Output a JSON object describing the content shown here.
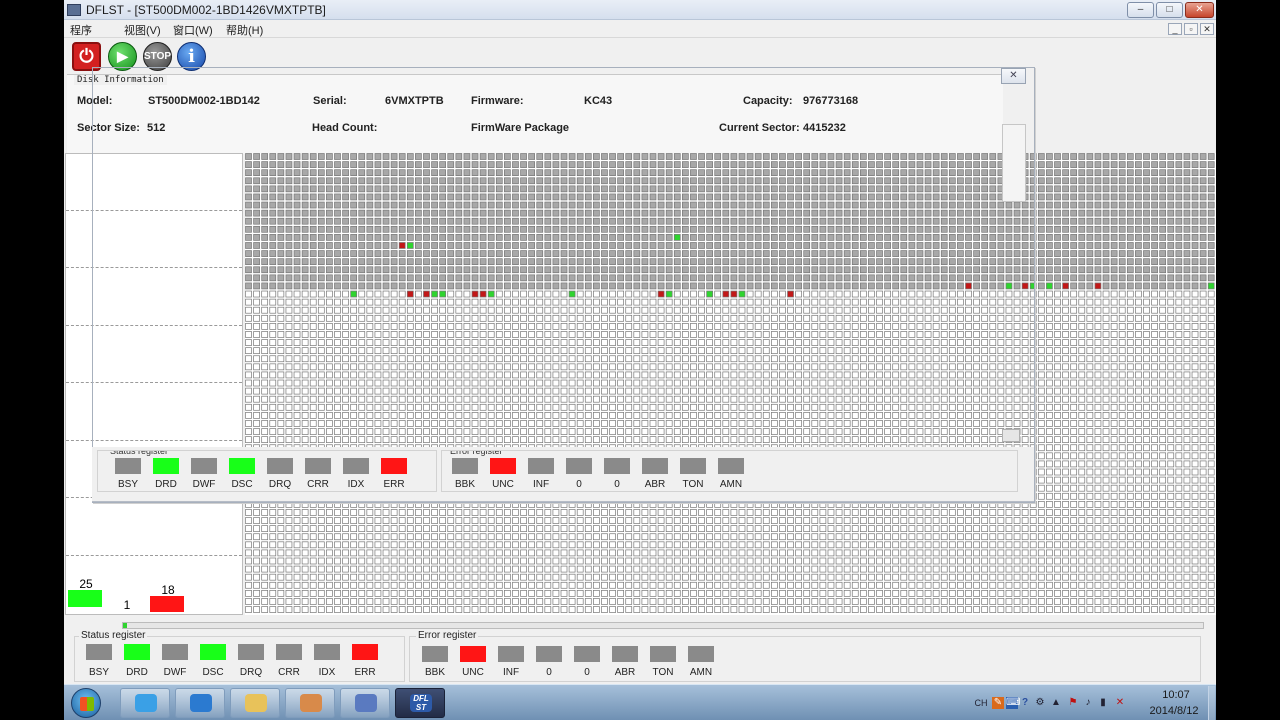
{
  "window": {
    "title": "DFLST - [ST500DM002-1BD1426VMXTPTB]",
    "buttons": {
      "minimize": "‒",
      "maximize": "□",
      "close": "✕"
    }
  },
  "menu": {
    "items": [
      "程序",
      "视图(V)",
      "窗口(W)",
      "帮助(H)"
    ],
    "mdi_buttons": [
      "_",
      "▫",
      "✕"
    ]
  },
  "toolbar": {
    "power": "⏻",
    "play": "▶",
    "stop": "STOP",
    "info": "i"
  },
  "disk_info": {
    "title": "Disk Information",
    "model_label": "Model:",
    "model": "ST500DM002-1BD142",
    "serial_label": "Serial:",
    "serial": "6VMXTPTB",
    "firmware_label": "Firmware:",
    "firmware": "KC43",
    "capacity_label": "Capacity:",
    "capacity": "976773168",
    "sector_size_label": "Sector Size:",
    "sector_size": "512",
    "head_count_label": "Head Count:",
    "firmware_package_label": "FirmWare Package",
    "current_sector_label": "Current Sector:",
    "current_sector": "4415232"
  },
  "popup": {
    "close": "✕",
    "status_title": "Status register",
    "error_title": "Error register"
  },
  "counters": [
    {
      "value": "25",
      "color": "#18ff18"
    },
    {
      "value": "1",
      "color": "#ffffff"
    },
    {
      "value": "18",
      "color": "#ff1515"
    }
  ],
  "sector_map": {
    "colors": {
      "filled": "#a8a8a8",
      "empty": "#ffffff",
      "ok": "#2fd42f",
      "bad": "#c21818",
      "border": "#777777"
    },
    "filled_rows": 17,
    "marks": [
      {
        "row": 11,
        "col": 19,
        "state": "bad"
      },
      {
        "row": 11,
        "col": 20,
        "state": "ok"
      },
      {
        "row": 10,
        "col": 53,
        "state": "ok"
      },
      {
        "row": 16,
        "col": 89,
        "state": "bad"
      },
      {
        "row": 16,
        "col": 94,
        "state": "ok"
      },
      {
        "row": 16,
        "col": 96,
        "state": "bad"
      },
      {
        "row": 16,
        "col": 97,
        "state": "ok"
      },
      {
        "row": 16,
        "col": 99,
        "state": "ok"
      },
      {
        "row": 16,
        "col": 101,
        "state": "bad"
      },
      {
        "row": 16,
        "col": 105,
        "state": "bad"
      },
      {
        "row": 16,
        "col": 119,
        "state": "ok"
      },
      {
        "row": 17,
        "col": 13,
        "state": "ok"
      },
      {
        "row": 17,
        "col": 20,
        "state": "bad"
      },
      {
        "row": 17,
        "col": 22,
        "state": "bad"
      },
      {
        "row": 17,
        "col": 23,
        "state": "ok"
      },
      {
        "row": 17,
        "col": 24,
        "state": "ok"
      },
      {
        "row": 17,
        "col": 28,
        "state": "bad"
      },
      {
        "row": 17,
        "col": 29,
        "state": "bad"
      },
      {
        "row": 17,
        "col": 30,
        "state": "ok"
      },
      {
        "row": 17,
        "col": 40,
        "state": "ok"
      },
      {
        "row": 17,
        "col": 51,
        "state": "bad"
      },
      {
        "row": 17,
        "col": 52,
        "state": "ok"
      },
      {
        "row": 17,
        "col": 57,
        "state": "ok"
      },
      {
        "row": 17,
        "col": 59,
        "state": "bad"
      },
      {
        "row": 17,
        "col": 60,
        "state": "bad"
      },
      {
        "row": 17,
        "col": 61,
        "state": "ok"
      },
      {
        "row": 17,
        "col": 67,
        "state": "bad"
      }
    ]
  },
  "progress": {
    "fraction": 0.004,
    "color": "#2fd42f"
  },
  "registers": {
    "status_title": "Status register",
    "error_title": "Error register",
    "status": [
      {
        "label": "BSY",
        "state": "gray"
      },
      {
        "label": "DRD",
        "state": "green"
      },
      {
        "label": "DWF",
        "state": "gray"
      },
      {
        "label": "DSC",
        "state": "green"
      },
      {
        "label": "DRQ",
        "state": "gray"
      },
      {
        "label": "CRR",
        "state": "gray"
      },
      {
        "label": "IDX",
        "state": "gray"
      },
      {
        "label": "ERR",
        "state": "red"
      }
    ],
    "error": [
      {
        "label": "BBK",
        "state": "gray"
      },
      {
        "label": "UNC",
        "state": "red"
      },
      {
        "label": "INF",
        "state": "gray"
      },
      {
        "label": "0",
        "state": "gray"
      },
      {
        "label": "0",
        "state": "gray"
      },
      {
        "label": "ABR",
        "state": "gray"
      },
      {
        "label": "TON",
        "state": "gray"
      },
      {
        "label": "AMN",
        "state": "gray"
      }
    ]
  },
  "taskbar": {
    "apps": [
      {
        "name": "taskbar-app-ie-blue",
        "icon": "ie-icon",
        "color": "#3aa0e6",
        "active": false
      },
      {
        "name": "taskbar-app-ie",
        "icon": "internet-explorer-icon",
        "color": "#2b7ad0",
        "active": false
      },
      {
        "name": "taskbar-app-explorer",
        "icon": "folder-icon",
        "color": "#e8c25a",
        "active": false
      },
      {
        "name": "taskbar-app-users",
        "icon": "users-icon",
        "color": "#d88a4a",
        "active": false
      },
      {
        "name": "taskbar-app-network",
        "icon": "network-icon",
        "color": "#5a7ac0",
        "active": false
      },
      {
        "name": "taskbar-app-dflst",
        "icon": "dflst-icon",
        "color": "#2d5aa8",
        "active": true
      }
    ],
    "dflst_icon_text": "DFL ST",
    "lang": "CH",
    "time": "10:07",
    "date": "2014/8/12"
  }
}
